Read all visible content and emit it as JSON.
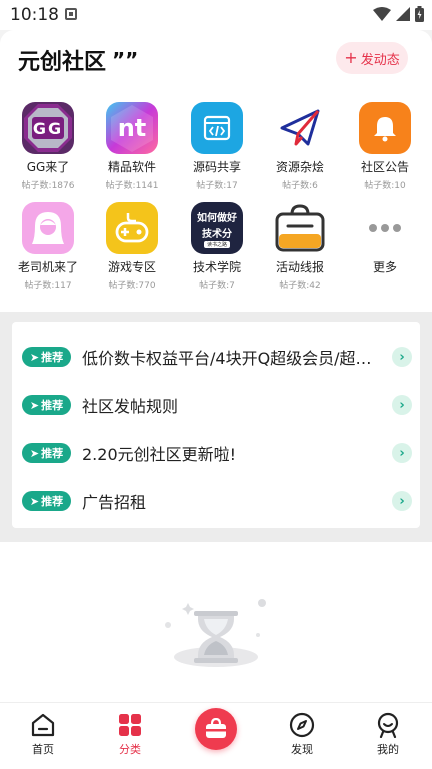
{
  "status": {
    "time": "10:18"
  },
  "header": {
    "title": "元创社区",
    "post_button": "发动态"
  },
  "categories": [
    {
      "name": "GG来了",
      "count": "帖子数:1876"
    },
    {
      "name": "精品软件",
      "count": "帖子数:1141"
    },
    {
      "name": "源码共享",
      "count": "帖子数:17"
    },
    {
      "name": "资源杂烩",
      "count": "帖子数:6"
    },
    {
      "name": "社区公告",
      "count": "帖子数:10"
    },
    {
      "name": "老司机来了",
      "count": "帖子数:117"
    },
    {
      "name": "游戏专区",
      "count": "帖子数:770"
    },
    {
      "name": "技术学院",
      "count": "帖子数:7"
    },
    {
      "name": "活动线报",
      "count": "帖子数:42"
    },
    {
      "name": "更多"
    }
  ],
  "icon_text": {
    "gg": "GG",
    "nt": "nt",
    "tech_line1": "如何做好",
    "tech_line2": "技术分",
    "tech_line3": "读书之路"
  },
  "pinned": {
    "badge": "推荐",
    "items": [
      "低价数卡权益平台/4块开Q超级会员/超…",
      "社区发帖规则",
      "2.20元创社区更新啦!",
      "广告招租"
    ]
  },
  "tabs": [
    {
      "label": "首页"
    },
    {
      "label": "分类"
    },
    {
      "label": "发现"
    },
    {
      "label": "我的"
    }
  ],
  "colors": {
    "accent": "#e5324a",
    "badge_green": "#1aa88a"
  }
}
